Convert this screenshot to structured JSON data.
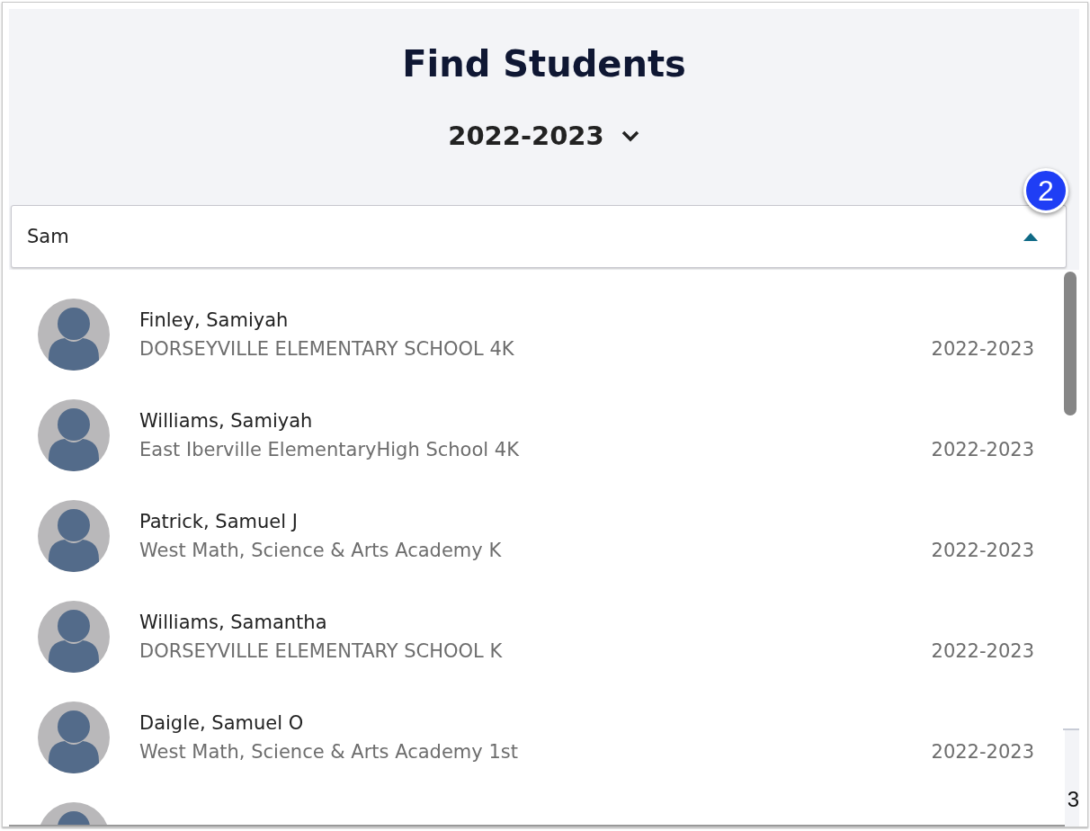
{
  "title": "Find Students",
  "year_selector": {
    "value": "2022-2023",
    "expanded": false
  },
  "search": {
    "value": "Sam",
    "expanded": true
  },
  "step_badge": "2",
  "results": [
    {
      "kind": "student",
      "name": "Finley, Samiyah",
      "school": "DORSEYVILLE ELEMENTARY SCHOOL 4K",
      "year": "2022-2023"
    },
    {
      "kind": "student",
      "name": "Williams, Samiyah",
      "school": "East Iberville ElementaryHigh School 4K",
      "year": "2022-2023"
    },
    {
      "kind": "student",
      "name": "Patrick, Samuel J",
      "school": "West Math, Science & Arts Academy K",
      "year": "2022-2023"
    },
    {
      "kind": "student",
      "name": "Williams, Samantha",
      "school": "DORSEYVILLE ELEMENTARY SCHOOL K",
      "year": "2022-2023"
    },
    {
      "kind": "student",
      "name": "Daigle, Samuel O",
      "school": "West Math, Science & Arts Academy 1st",
      "year": "2022-2023"
    },
    {
      "kind": "cut"
    }
  ],
  "background_fragment": "3"
}
